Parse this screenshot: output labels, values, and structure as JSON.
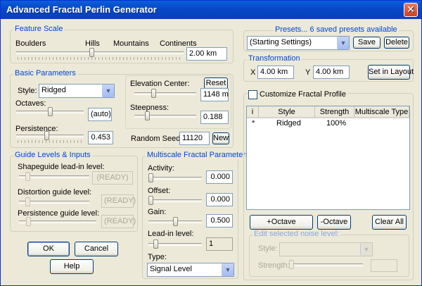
{
  "window": {
    "title": "Advanced Fractal Perlin Generator",
    "close_glyph": "✕"
  },
  "feature_scale": {
    "title": "Feature Scale",
    "labels": [
      "Boulders",
      "Hills",
      "Mountains",
      "Continents"
    ],
    "value": "2.00 km"
  },
  "basic": {
    "title": "Basic Parameters",
    "style_label": "Style:",
    "style_value": "Ridged",
    "octaves_label": "Octaves:",
    "octaves_value": "(auto)",
    "persistence_label": "Persistence:",
    "persistence_value": "0.453",
    "elevation_label": "Elevation Center:",
    "reset_label": "Reset",
    "elevation_value": "1148 m",
    "steepness_label": "Steepness:",
    "steepness_value": "0.188",
    "seed_label": "Random Seed:",
    "seed_value": "11120",
    "new_label": "New"
  },
  "guide": {
    "title": "Guide Levels & Inputs",
    "shape_label": "Shapeguide lead-in level:",
    "shape_value": "(READY)",
    "distortion_label": "Distortion guide level:",
    "distortion_value": "(READY)",
    "persist_label": "Persistence guide level:",
    "persist_value": "(READY)"
  },
  "multiscale": {
    "title": "Multiscale Fractal Parameters",
    "activity_label": "Activity:",
    "activity_value": "0.000",
    "offset_label": "Offset:",
    "offset_value": "0.000",
    "gain_label": "Gain:",
    "gain_value": "0.500",
    "leadin_label": "Lead-in level:",
    "leadin_value": "1",
    "type_label": "Type:",
    "type_value": "Signal Level"
  },
  "buttons": {
    "ok": "OK",
    "cancel": "Cancel",
    "help": "Help"
  },
  "presets": {
    "title": "Presets... 6 saved presets available",
    "selected": "(Starting Settings)",
    "save": "Save",
    "delete": "Delete"
  },
  "transformation": {
    "title": "Transformation",
    "x_label": "X",
    "x_value": "4.00 km",
    "y_label": "Y",
    "y_value": "4.00 km",
    "set_layout": "Set in Layout"
  },
  "profile": {
    "checkbox_label": "Customize Fractal Profile",
    "columns": [
      "i",
      "Style",
      "Strength",
      "Multiscale Type"
    ],
    "rows": [
      {
        "i": "*",
        "style": "Ridged",
        "strength": "100%",
        "mstype": ""
      }
    ],
    "add_octave": "+Octave",
    "remove_octave": "-Octave",
    "clear_all": "Clear All"
  },
  "edit_noise": {
    "title": "Edit selected noise level:",
    "style_label": "Style:",
    "strength_label": "Strength:"
  },
  "sliders": {
    "feature_scale": 0.45,
    "octaves": 0.5,
    "persistence": 0.45,
    "elevation": 0.3,
    "steepness": 0.19,
    "shape": 0.1,
    "distortion": 0.1,
    "persist_guide": 0.1,
    "activity": 0.0,
    "offset": 0.0,
    "gain": 0.5,
    "leadin": 0.1,
    "strength": 0.0
  }
}
